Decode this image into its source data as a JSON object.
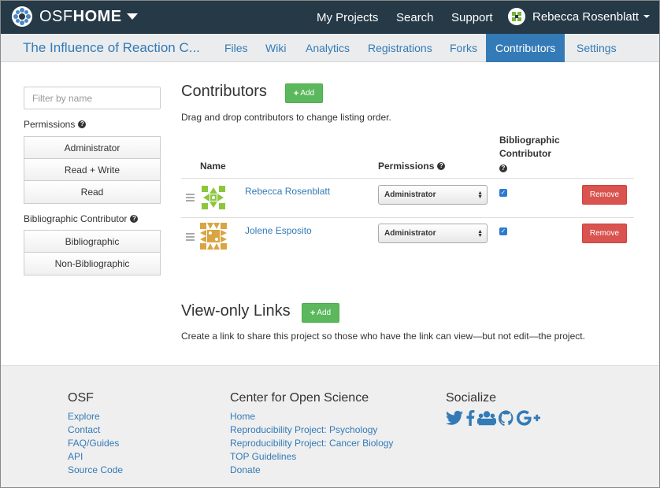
{
  "brand": {
    "osf": "OSF",
    "home": "HOME"
  },
  "topnav": {
    "my_projects": "My Projects",
    "search": "Search",
    "support": "Support",
    "user_name": "Rebecca Rosenblatt"
  },
  "project": {
    "title": "The Influence of Reaction C...",
    "tabs": [
      {
        "label": "Files"
      },
      {
        "label": "Wiki"
      },
      {
        "label": "Analytics"
      },
      {
        "label": "Registrations"
      },
      {
        "label": "Forks"
      },
      {
        "label": "Contributors"
      },
      {
        "label": "Settings"
      }
    ],
    "active_tab": "Contributors"
  },
  "sidebar": {
    "filter_placeholder": "Filter by name",
    "permissions_label": "Permissions",
    "permissions": [
      "Administrator",
      "Read + Write",
      "Read"
    ],
    "bibliographic_label": "Bibliographic Contributor",
    "bibliographic": [
      "Bibliographic",
      "Non-Bibliographic"
    ]
  },
  "contributors": {
    "heading": "Contributors",
    "add_label": "Add",
    "instructions": "Drag and drop contributors to change listing order.",
    "columns": {
      "name": "Name",
      "permissions": "Permissions",
      "bibliographic_1": "Bibliographic",
      "bibliographic_2": "Contributor"
    },
    "rows": [
      {
        "name": "Rebecca Rosenblatt",
        "permission": "Administrator",
        "bibliographic": true,
        "remove_label": "Remove"
      },
      {
        "name": "Jolene Esposito",
        "permission": "Administrator",
        "bibliographic": true,
        "remove_label": "Remove"
      }
    ]
  },
  "view_only": {
    "heading": "View-only Links",
    "add_label": "Add",
    "description": "Create a link to share this project so those who have the link can view—but not edit—the project."
  },
  "footer": {
    "osf": {
      "heading": "OSF",
      "links": [
        "Explore",
        "Contact",
        "FAQ/Guides",
        "API",
        "Source Code"
      ]
    },
    "cos": {
      "heading": "Center for Open Science",
      "links": [
        "Home",
        "Reproducibility Project: Psychology",
        "Reproducibility Project: Cancer Biology",
        "TOP Guidelines",
        "Donate"
      ]
    },
    "socialize": {
      "heading": "Socialize",
      "icons": [
        "twitter-icon",
        "facebook-icon",
        "group-icon",
        "github-icon",
        "google-plus-icon"
      ]
    }
  },
  "colors": {
    "topbar": "#263947",
    "link": "#337ab7",
    "add_button": "#5cb85c",
    "remove_button": "#d9534f",
    "active_tab": "#337ab7"
  }
}
